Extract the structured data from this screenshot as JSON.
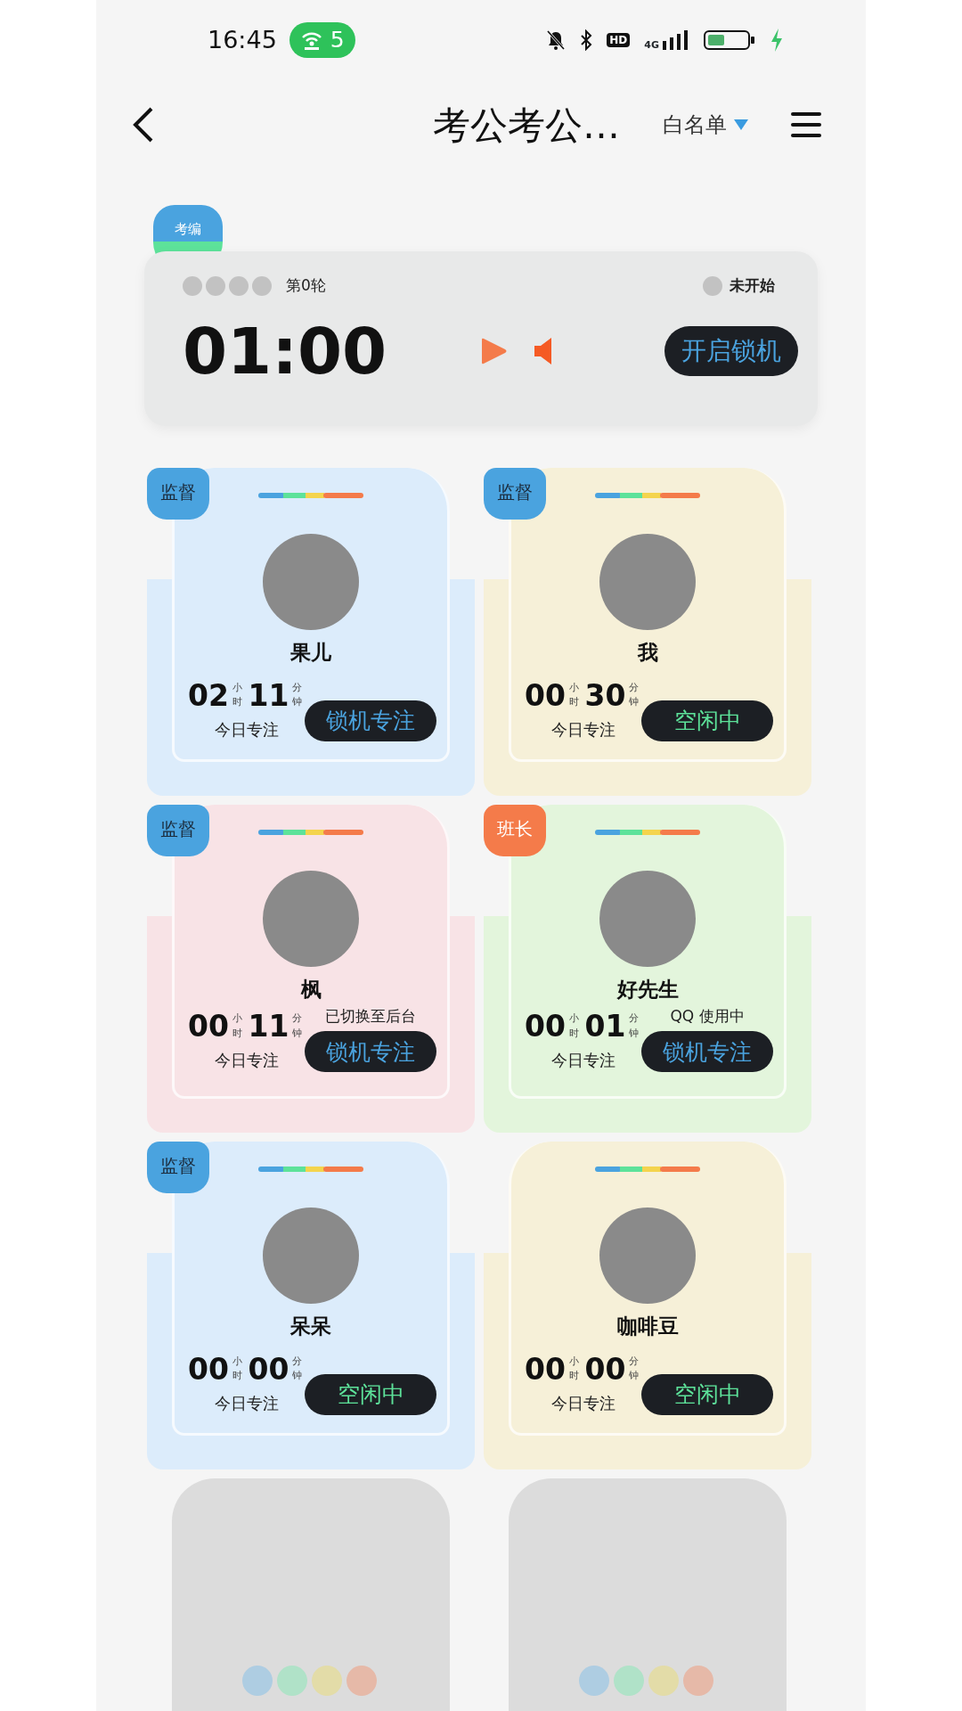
{
  "status_bar": {
    "time": "16:45",
    "hotspot_count": "5",
    "hd": "HD",
    "network": "4G"
  },
  "nav": {
    "title": "考公考公…",
    "filter": "白名单"
  },
  "category_badge": "考编",
  "timer": {
    "round_dots": [
      {
        "done": false
      },
      {
        "done": false
      },
      {
        "done": false
      },
      {
        "done": false
      }
    ],
    "round_label": "第0轮",
    "status": {
      "label": "未开始",
      "active": false
    },
    "time": "01:00",
    "start_button": "开启锁机"
  },
  "members": [
    {
      "name": "果儿",
      "color": "#dcecfb",
      "role": {
        "label": "监督",
        "kind": "supervisor"
      },
      "hours": "02",
      "hours_unit": "小时",
      "minutes": "11",
      "minutes_unit": "分钟",
      "caption": "今日专注",
      "status": {
        "label": "锁机专注",
        "kind": "focus"
      }
    },
    {
      "name": "我",
      "color": "#f6f0d8",
      "role": {
        "label": "监督",
        "kind": "supervisor"
      },
      "hours": "00",
      "hours_unit": "小时",
      "minutes": "30",
      "minutes_unit": "分钟",
      "caption": "今日专注",
      "status": {
        "label": "空闲中",
        "kind": "idle"
      }
    },
    {
      "name": "枫",
      "color": "#f8e3e6",
      "role": {
        "label": "监督",
        "kind": "supervisor"
      },
      "hours": "00",
      "hours_unit": "小时",
      "minutes": "11",
      "minutes_unit": "分钟",
      "caption": "今日专注",
      "note": "已切换至后台",
      "status": {
        "label": "锁机专注",
        "kind": "focus"
      }
    },
    {
      "name": "好先生",
      "color": "#e3f5dc",
      "role": {
        "label": "班长",
        "kind": "monitor"
      },
      "hours": "00",
      "hours_unit": "小时",
      "minutes": "01",
      "minutes_unit": "分钟",
      "caption": "今日专注",
      "note": "QQ 使用中",
      "status": {
        "label": "锁机专注",
        "kind": "focus"
      }
    },
    {
      "name": "呆呆",
      "color": "#dcecfb",
      "role": {
        "label": "监督",
        "kind": "supervisor"
      },
      "hours": "00",
      "hours_unit": "小时",
      "minutes": "00",
      "minutes_unit": "分钟",
      "caption": "今日专注",
      "status": {
        "label": "空闲中",
        "kind": "idle"
      }
    },
    {
      "name": "咖啡豆",
      "color": "#f6f0d8",
      "hours": "00",
      "hours_unit": "小时",
      "minutes": "00",
      "minutes_unit": "分钟",
      "caption": "今日专注",
      "status": {
        "label": "空闲中",
        "kind": "idle"
      }
    }
  ],
  "empty_seats": [
    {
      "kind": "empty"
    },
    {
      "kind": "empty"
    }
  ]
}
